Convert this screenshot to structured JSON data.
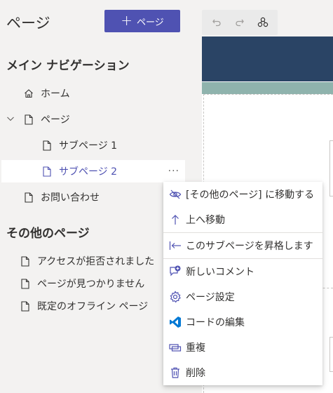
{
  "left_pane": {
    "title": "ページ",
    "new_page_button": {
      "icon": "plus-icon",
      "label": "ページ"
    },
    "main_nav": {
      "heading": "メイン ナビゲーション",
      "items": [
        {
          "label": "ホーム",
          "icon": "home-icon"
        },
        {
          "label": "ページ",
          "icon": "page-icon",
          "expanded": true
        },
        {
          "label": "サブページ 1",
          "icon": "page-icon"
        },
        {
          "label": "サブページ 2",
          "icon": "page-icon",
          "selected": true
        },
        {
          "label": "お問い合わせ",
          "icon": "page-icon"
        }
      ]
    },
    "other_pages": {
      "heading": "その他のページ",
      "items": [
        {
          "label": "アクセスが拒否されました",
          "icon": "page-icon"
        },
        {
          "label": "ページが見つかりません",
          "icon": "page-icon"
        },
        {
          "label": "既定のオフライン ページ",
          "icon": "page-icon"
        }
      ]
    },
    "more_button": "···"
  },
  "toolbar": {
    "buttons": [
      "undo-icon",
      "redo-icon",
      "site-map-icon"
    ]
  },
  "context_menu": {
    "items": [
      {
        "label": "[その他のページ] に移動する",
        "icon": "hidden-eye-icon"
      },
      {
        "label": "上へ移動",
        "icon": "arrow-up-icon"
      },
      {
        "label": "このサブページを昇格します",
        "icon": "promote-icon"
      },
      {
        "label": "新しいコメント",
        "icon": "comment-add-icon"
      },
      {
        "label": "ページ設定",
        "icon": "gear-icon"
      },
      {
        "label": "コードの編集",
        "icon": "vscode-icon"
      },
      {
        "label": "重複",
        "icon": "duplicate-icon"
      },
      {
        "label": "削除",
        "icon": "trash-icon"
      }
    ]
  },
  "colors": {
    "accent": "#4f52b2",
    "header_band": "#2a4465",
    "sub_band": "#8fb3ad",
    "vscode_blue": "#0078d4"
  }
}
